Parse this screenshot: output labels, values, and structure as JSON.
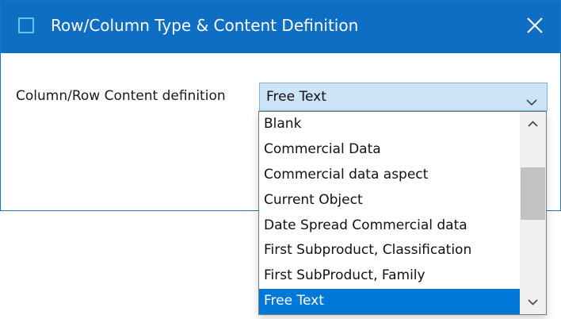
{
  "window": {
    "title": "Row/Column Type & Content Definition",
    "close_icon": "close-icon",
    "accent_color": "#0e6ec4"
  },
  "form": {
    "label": "Column/Row Content definition",
    "combo_value": "Free Text"
  },
  "dropdown": {
    "items": [
      "Blank",
      "Commercial Data",
      "Commercial data aspect",
      "Current Object",
      "Date Spread Commercial data",
      "First Subproduct, Classification",
      "First SubProduct, Family",
      "Free Text"
    ],
    "selected": "Free Text",
    "selected_color": "#0078d7"
  }
}
